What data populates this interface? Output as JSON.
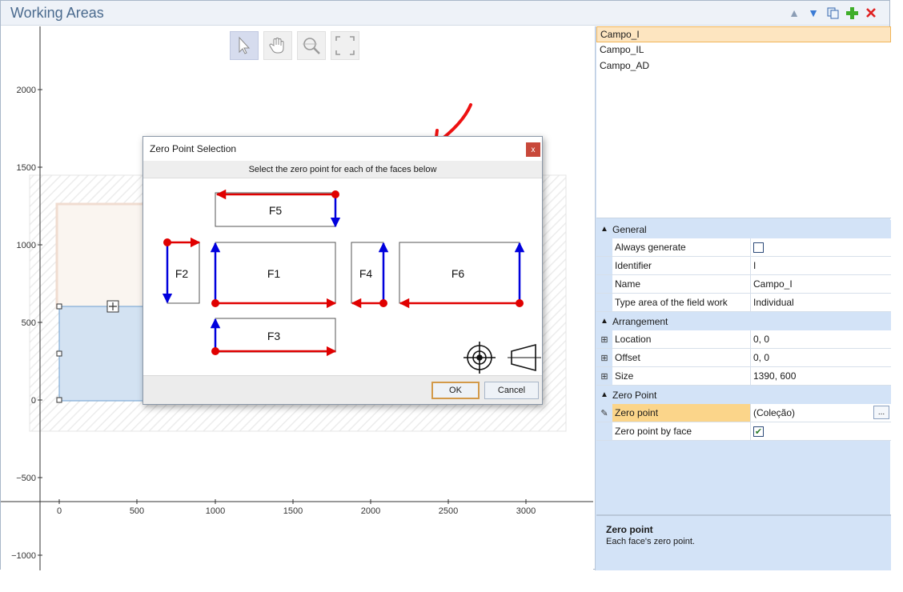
{
  "window": {
    "title": "Working Areas"
  },
  "colors": {
    "accent": "#4a6a8e",
    "selection": "#fde5c0",
    "edge_red": "#e00000",
    "edge_blue": "#0000dd"
  },
  "toolbar_icons": [
    "move-up-icon",
    "move-down-icon",
    "copy-icon",
    "add-icon",
    "delete-icon"
  ],
  "canvas": {
    "tools": [
      "pointer-icon",
      "hand-icon",
      "zoom-icon",
      "fit-icon"
    ],
    "y_ticks": [
      "2000",
      "1500",
      "1000",
      "500",
      "0",
      "−500",
      "−1000"
    ],
    "x_ticks": [
      "0",
      "500",
      "1000",
      "1500",
      "2000",
      "2500",
      "3000"
    ]
  },
  "areas": [
    "Campo_I",
    "Campo_IL",
    "Campo_AD"
  ],
  "properties": {
    "general": {
      "label": "General",
      "always_generate": "Always generate",
      "identifier_label": "Identifier",
      "identifier_value": "I",
      "name_label": "Name",
      "name_value": "Campo_I",
      "type_label": "Type area of the field work",
      "type_value": "Individual"
    },
    "arrangement": {
      "label": "Arrangement",
      "location_label": "Location",
      "location_value": "0, 0",
      "offset_label": "Offset",
      "offset_value": "0, 0",
      "size_label": "Size",
      "size_value": "1390, 600"
    },
    "zero_point": {
      "label": "Zero Point",
      "zp_label": "Zero point",
      "zp_value": "(Coleção)",
      "zp_by_face_label": "Zero point by face"
    }
  },
  "description": {
    "title": "Zero point",
    "text": "Each face's zero point."
  },
  "dialog": {
    "title": "Zero Point Selection",
    "close": "x",
    "subtitle": "Select the zero point for each of the faces below",
    "faces": {
      "F1": "F1",
      "F2": "F2",
      "F3": "F3",
      "F4": "F4",
      "F5": "F5",
      "F6": "F6"
    },
    "ok": "OK",
    "cancel": "Cancel"
  }
}
